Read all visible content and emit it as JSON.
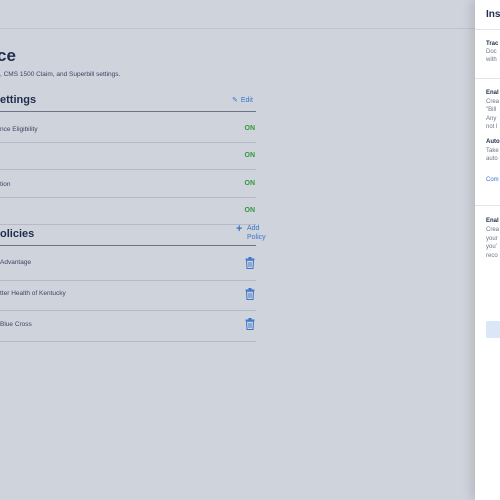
{
  "page": {
    "title": "ce",
    "subtitle": ", CMS 1500 Claim, and Superbill settings."
  },
  "settings": {
    "title": "ettings",
    "edit_label": "Edit",
    "rows": [
      {
        "label": "nce Eligibility",
        "status": "ON"
      },
      {
        "label": "",
        "status": "ON"
      },
      {
        "label": "tion",
        "status": "ON"
      },
      {
        "label": "",
        "status": "ON"
      }
    ]
  },
  "policies": {
    "title": "olicies",
    "add_label": "Add Policy",
    "rows": [
      {
        "label": "Advantage"
      },
      {
        "label": "tter Health of Kentucky"
      },
      {
        "label": "Blue Cross"
      }
    ]
  },
  "panel": {
    "title": "Ins",
    "sections": [
      {
        "heading": "Trac",
        "lines": [
          "Doc",
          "with"
        ]
      },
      {
        "heading": "Enal",
        "lines": [
          "Crea",
          "\"Bill",
          "Any",
          "not l"
        ]
      },
      {
        "heading": "Auto",
        "lines": [
          "Take",
          "auto"
        ]
      },
      {
        "link": "Com"
      },
      {
        "heading": "Enal",
        "lines": [
          "Crea",
          "your",
          "you'",
          "reco"
        ]
      }
    ]
  },
  "colors": {
    "accent": "#3c74c9",
    "on_status": "#2f9a3c",
    "heading": "#1f2d4d",
    "overlay_bg": "#cfd3db"
  },
  "icons": {
    "edit": "pencil-icon",
    "add": "plus-icon",
    "delete": "trash-icon"
  }
}
